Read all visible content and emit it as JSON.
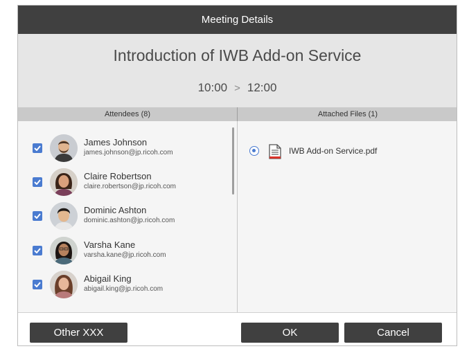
{
  "dialog": {
    "title": "Meeting Details",
    "meeting_title": "Introduction of IWB Add-on Service",
    "start_time": "10:00",
    "time_separator": ">",
    "end_time": "12:00"
  },
  "attendees_panel": {
    "header": "Attendees (8)",
    "items": [
      {
        "name": "James Johnson",
        "email": "james.johnson@jp.ricoh.com",
        "checked": true
      },
      {
        "name": "Claire Robertson",
        "email": "claire.robertson@jp.ricoh.com",
        "checked": true
      },
      {
        "name": "Dominic Ashton",
        "email": "dominic.ashton@jp.ricoh.com",
        "checked": true
      },
      {
        "name": "Varsha Kane",
        "email": "varsha.kane@jp.ricoh.com",
        "checked": true
      },
      {
        "name": "Abigail King",
        "email": "abigail.king@jp.ricoh.com",
        "checked": true
      }
    ]
  },
  "files_panel": {
    "header": "Attached Files (1)",
    "items": [
      {
        "name": "IWB Add-on Service.pdf",
        "selected": true,
        "icon": "document-icon"
      }
    ]
  },
  "footer": {
    "other_label": "Other XXX",
    "ok_label": "OK",
    "cancel_label": "Cancel"
  },
  "colors": {
    "titlebar": "#404040",
    "accent": "#4a7bd0",
    "button": "#404040",
    "pdf_red": "#d9342b"
  }
}
